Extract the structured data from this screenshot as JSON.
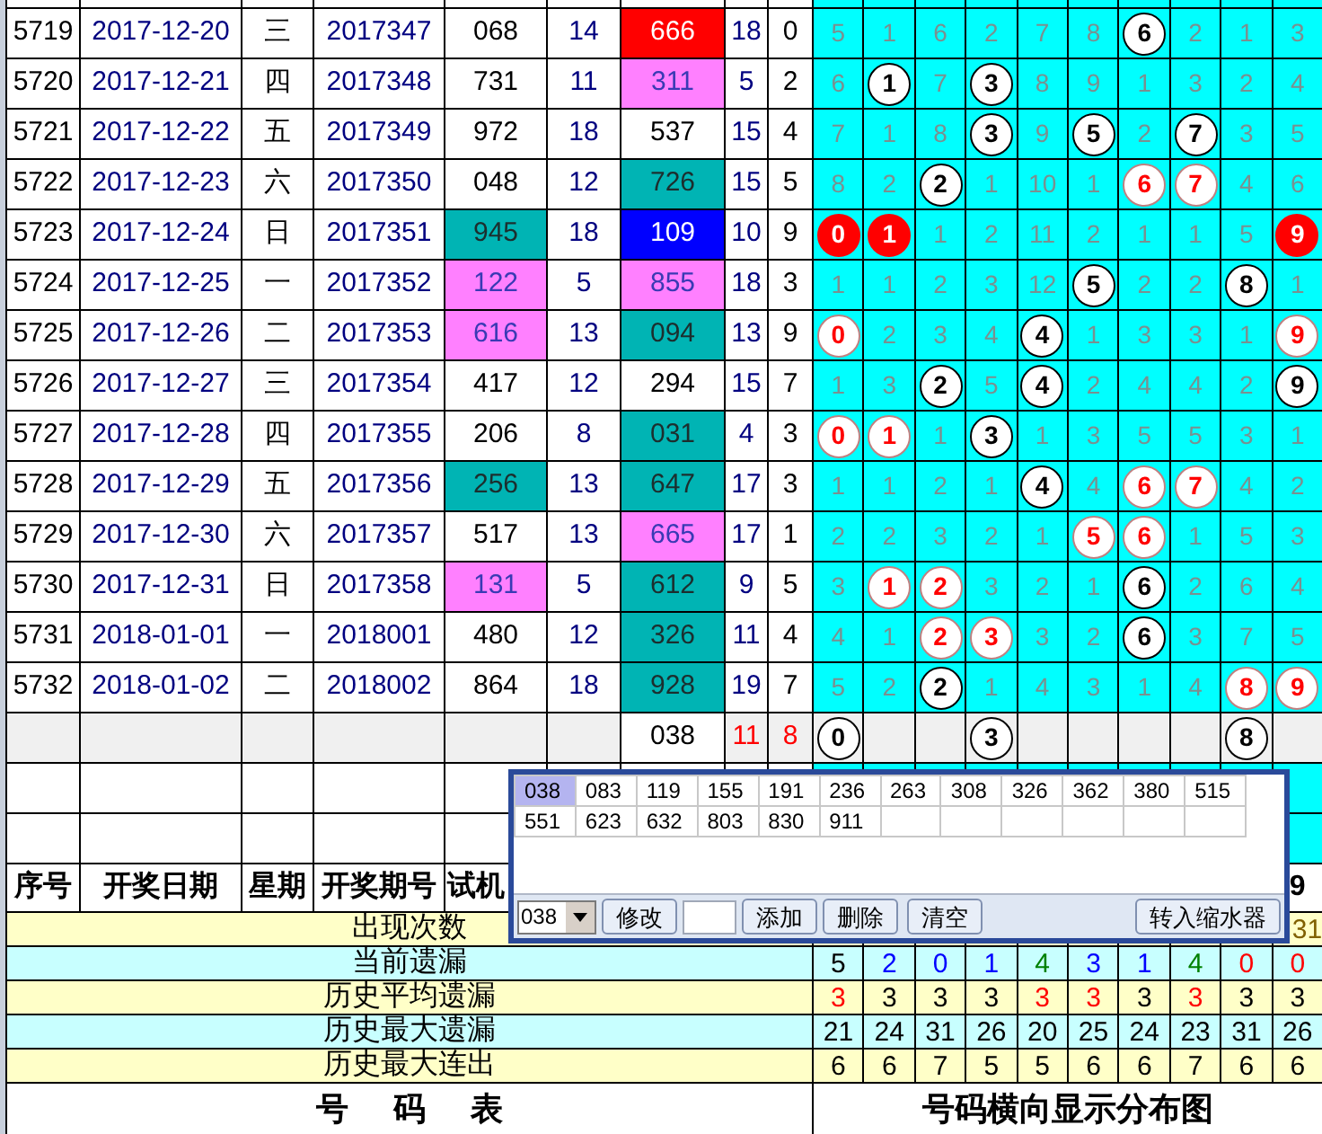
{
  "rows": [
    {
      "seq": "5719",
      "date": "2017-12-20",
      "weekday": "三",
      "issue": "2017347",
      "trial": {
        "text": "068"
      },
      "trial_sum": "14",
      "draw": {
        "text": "666",
        "color": "#ff0000"
      },
      "sum": "18",
      "span": "0",
      "dist": [
        {
          "text": "5",
          "kind": "miss"
        },
        {
          "text": "1",
          "kind": "miss"
        },
        {
          "text": "6",
          "kind": "miss"
        },
        {
          "text": "2",
          "kind": "miss"
        },
        {
          "text": "7",
          "kind": "miss"
        },
        {
          "text": "8",
          "kind": "miss"
        },
        {
          "text": "6",
          "kind": "hit"
        },
        {
          "text": "2",
          "kind": "miss"
        },
        {
          "text": "1",
          "kind": "miss"
        },
        {
          "text": "3",
          "kind": "miss"
        }
      ]
    },
    {
      "seq": "5720",
      "date": "2017-12-21",
      "weekday": "四",
      "issue": "2017348",
      "trial": {
        "text": "731"
      },
      "trial_sum": "11",
      "draw": {
        "text": "311",
        "color": "#ff80ff"
      },
      "sum": "5",
      "span": "2",
      "dist": [
        {
          "text": "6",
          "kind": "miss"
        },
        {
          "text": "1",
          "kind": "hit"
        },
        {
          "text": "7",
          "kind": "miss"
        },
        {
          "text": "3",
          "kind": "hit"
        },
        {
          "text": "8",
          "kind": "miss"
        },
        {
          "text": "9",
          "kind": "miss"
        },
        {
          "text": "1",
          "kind": "miss"
        },
        {
          "text": "3",
          "kind": "miss"
        },
        {
          "text": "2",
          "kind": "miss"
        },
        {
          "text": "4",
          "kind": "miss"
        }
      ]
    },
    {
      "seq": "5721",
      "date": "2017-12-22",
      "weekday": "五",
      "issue": "2017349",
      "trial": {
        "text": "972"
      },
      "trial_sum": "18",
      "draw": {
        "text": "537"
      },
      "sum": "15",
      "span": "4",
      "dist": [
        {
          "text": "7",
          "kind": "miss"
        },
        {
          "text": "1",
          "kind": "miss"
        },
        {
          "text": "8",
          "kind": "miss"
        },
        {
          "text": "3",
          "kind": "hit"
        },
        {
          "text": "9",
          "kind": "miss"
        },
        {
          "text": "5",
          "kind": "hit"
        },
        {
          "text": "2",
          "kind": "miss"
        },
        {
          "text": "7",
          "kind": "hit"
        },
        {
          "text": "3",
          "kind": "miss"
        },
        {
          "text": "5",
          "kind": "miss"
        }
      ]
    },
    {
      "seq": "5722",
      "date": "2017-12-23",
      "weekday": "六",
      "issue": "2017350",
      "trial": {
        "text": "048"
      },
      "trial_sum": "12",
      "draw": {
        "text": "726",
        "color": "#00b4b4"
      },
      "sum": "15",
      "span": "5",
      "dist": [
        {
          "text": "8",
          "kind": "miss"
        },
        {
          "text": "2",
          "kind": "miss"
        },
        {
          "text": "2",
          "kind": "hit"
        },
        {
          "text": "1",
          "kind": "miss"
        },
        {
          "text": "10",
          "kind": "miss"
        },
        {
          "text": "1",
          "kind": "miss"
        },
        {
          "text": "6",
          "kind": "hit_red"
        },
        {
          "text": "7",
          "kind": "hit_red"
        },
        {
          "text": "4",
          "kind": "miss"
        },
        {
          "text": "6",
          "kind": "miss"
        }
      ]
    },
    {
      "seq": "5723",
      "date": "2017-12-24",
      "weekday": "日",
      "issue": "2017351",
      "trial": {
        "text": "945",
        "color": "#00b4b4"
      },
      "trial_sum": "18",
      "draw": {
        "text": "109",
        "color": "#0000ff"
      },
      "sum": "10",
      "span": "9",
      "dist": [
        {
          "text": "0",
          "kind": "hit_solid"
        },
        {
          "text": "1",
          "kind": "hit_solid"
        },
        {
          "text": "1",
          "kind": "miss"
        },
        {
          "text": "2",
          "kind": "miss"
        },
        {
          "text": "11",
          "kind": "miss"
        },
        {
          "text": "2",
          "kind": "miss"
        },
        {
          "text": "1",
          "kind": "miss"
        },
        {
          "text": "1",
          "kind": "miss"
        },
        {
          "text": "5",
          "kind": "miss"
        },
        {
          "text": "9",
          "kind": "hit_solid"
        }
      ]
    },
    {
      "seq": "5724",
      "date": "2017-12-25",
      "weekday": "一",
      "issue": "2017352",
      "trial": {
        "text": "122",
        "color": "#ff80ff"
      },
      "trial_sum": "5",
      "draw": {
        "text": "855",
        "color": "#ff80ff"
      },
      "sum": "18",
      "span": "3",
      "dist": [
        {
          "text": "1",
          "kind": "miss"
        },
        {
          "text": "1",
          "kind": "miss"
        },
        {
          "text": "2",
          "kind": "miss"
        },
        {
          "text": "3",
          "kind": "miss"
        },
        {
          "text": "12",
          "kind": "miss"
        },
        {
          "text": "5",
          "kind": "hit"
        },
        {
          "text": "2",
          "kind": "miss"
        },
        {
          "text": "2",
          "kind": "miss"
        },
        {
          "text": "8",
          "kind": "hit"
        },
        {
          "text": "1",
          "kind": "miss"
        }
      ]
    },
    {
      "seq": "5725",
      "date": "2017-12-26",
      "weekday": "二",
      "issue": "2017353",
      "trial": {
        "text": "616",
        "color": "#ff80ff"
      },
      "trial_sum": "13",
      "draw": {
        "text": "094",
        "color": "#00b4b4"
      },
      "sum": "13",
      "span": "9",
      "dist": [
        {
          "text": "0",
          "kind": "hit_red"
        },
        {
          "text": "2",
          "kind": "miss"
        },
        {
          "text": "3",
          "kind": "miss"
        },
        {
          "text": "4",
          "kind": "miss"
        },
        {
          "text": "4",
          "kind": "hit"
        },
        {
          "text": "1",
          "kind": "miss"
        },
        {
          "text": "3",
          "kind": "miss"
        },
        {
          "text": "3",
          "kind": "miss"
        },
        {
          "text": "1",
          "kind": "miss"
        },
        {
          "text": "9",
          "kind": "hit_red"
        }
      ]
    },
    {
      "seq": "5726",
      "date": "2017-12-27",
      "weekday": "三",
      "issue": "2017354",
      "trial": {
        "text": "417"
      },
      "trial_sum": "12",
      "draw": {
        "text": "294"
      },
      "sum": "15",
      "span": "7",
      "dist": [
        {
          "text": "1",
          "kind": "miss"
        },
        {
          "text": "3",
          "kind": "miss"
        },
        {
          "text": "2",
          "kind": "hit"
        },
        {
          "text": "5",
          "kind": "miss"
        },
        {
          "text": "4",
          "kind": "hit"
        },
        {
          "text": "2",
          "kind": "miss"
        },
        {
          "text": "4",
          "kind": "miss"
        },
        {
          "text": "4",
          "kind": "miss"
        },
        {
          "text": "2",
          "kind": "miss"
        },
        {
          "text": "9",
          "kind": "hit"
        }
      ]
    },
    {
      "seq": "5727",
      "date": "2017-12-28",
      "weekday": "四",
      "issue": "2017355",
      "trial": {
        "text": "206"
      },
      "trial_sum": "8",
      "draw": {
        "text": "031",
        "color": "#00b4b4"
      },
      "sum": "4",
      "span": "3",
      "dist": [
        {
          "text": "0",
          "kind": "hit_red"
        },
        {
          "text": "1",
          "kind": "hit_red"
        },
        {
          "text": "1",
          "kind": "miss"
        },
        {
          "text": "3",
          "kind": "hit"
        },
        {
          "text": "1",
          "kind": "miss"
        },
        {
          "text": "3",
          "kind": "miss"
        },
        {
          "text": "5",
          "kind": "miss"
        },
        {
          "text": "5",
          "kind": "miss"
        },
        {
          "text": "3",
          "kind": "miss"
        },
        {
          "text": "1",
          "kind": "miss"
        }
      ]
    },
    {
      "seq": "5728",
      "date": "2017-12-29",
      "weekday": "五",
      "issue": "2017356",
      "trial": {
        "text": "256",
        "color": "#00b4b4"
      },
      "trial_sum": "13",
      "draw": {
        "text": "647",
        "color": "#00b4b4"
      },
      "sum": "17",
      "span": "3",
      "dist": [
        {
          "text": "1",
          "kind": "miss"
        },
        {
          "text": "1",
          "kind": "miss"
        },
        {
          "text": "2",
          "kind": "miss"
        },
        {
          "text": "1",
          "kind": "miss"
        },
        {
          "text": "4",
          "kind": "hit"
        },
        {
          "text": "4",
          "kind": "miss"
        },
        {
          "text": "6",
          "kind": "hit_red"
        },
        {
          "text": "7",
          "kind": "hit_red"
        },
        {
          "text": "4",
          "kind": "miss"
        },
        {
          "text": "2",
          "kind": "miss"
        }
      ]
    },
    {
      "seq": "5729",
      "date": "2017-12-30",
      "weekday": "六",
      "issue": "2017357",
      "trial": {
        "text": "517"
      },
      "trial_sum": "13",
      "draw": {
        "text": "665",
        "color": "#ff80ff"
      },
      "sum": "17",
      "span": "1",
      "dist": [
        {
          "text": "2",
          "kind": "miss"
        },
        {
          "text": "2",
          "kind": "miss"
        },
        {
          "text": "3",
          "kind": "miss"
        },
        {
          "text": "2",
          "kind": "miss"
        },
        {
          "text": "1",
          "kind": "miss"
        },
        {
          "text": "5",
          "kind": "hit_red"
        },
        {
          "text": "6",
          "kind": "hit_red"
        },
        {
          "text": "1",
          "kind": "miss"
        },
        {
          "text": "5",
          "kind": "miss"
        },
        {
          "text": "3",
          "kind": "miss"
        }
      ]
    },
    {
      "seq": "5730",
      "date": "2017-12-31",
      "weekday": "日",
      "issue": "2017358",
      "trial": {
        "text": "131",
        "color": "#ff80ff"
      },
      "trial_sum": "5",
      "draw": {
        "text": "612",
        "color": "#00b4b4"
      },
      "sum": "9",
      "span": "5",
      "dist": [
        {
          "text": "3",
          "kind": "miss"
        },
        {
          "text": "1",
          "kind": "hit_red"
        },
        {
          "text": "2",
          "kind": "hit_red"
        },
        {
          "text": "3",
          "kind": "miss"
        },
        {
          "text": "2",
          "kind": "miss"
        },
        {
          "text": "1",
          "kind": "miss"
        },
        {
          "text": "6",
          "kind": "hit"
        },
        {
          "text": "2",
          "kind": "miss"
        },
        {
          "text": "6",
          "kind": "miss"
        },
        {
          "text": "4",
          "kind": "miss"
        }
      ]
    },
    {
      "seq": "5731",
      "date": "2018-01-01",
      "weekday": "一",
      "issue": "2018001",
      "trial": {
        "text": "480"
      },
      "trial_sum": "12",
      "draw": {
        "text": "326",
        "color": "#00b4b4"
      },
      "sum": "11",
      "span": "4",
      "dist": [
        {
          "text": "4",
          "kind": "miss"
        },
        {
          "text": "1",
          "kind": "miss"
        },
        {
          "text": "2",
          "kind": "hit_red"
        },
        {
          "text": "3",
          "kind": "hit_red"
        },
        {
          "text": "3",
          "kind": "miss"
        },
        {
          "text": "2",
          "kind": "miss"
        },
        {
          "text": "6",
          "kind": "hit"
        },
        {
          "text": "3",
          "kind": "miss"
        },
        {
          "text": "7",
          "kind": "miss"
        },
        {
          "text": "5",
          "kind": "miss"
        }
      ]
    },
    {
      "seq": "5732",
      "date": "2018-01-02",
      "weekday": "二",
      "issue": "2018002",
      "trial": {
        "text": "864"
      },
      "trial_sum": "18",
      "draw": {
        "text": "928",
        "color": "#00b4b4"
      },
      "sum": "19",
      "span": "7",
      "dist": [
        {
          "text": "5",
          "kind": "miss"
        },
        {
          "text": "2",
          "kind": "miss"
        },
        {
          "text": "2",
          "kind": "hit"
        },
        {
          "text": "1",
          "kind": "miss"
        },
        {
          "text": "4",
          "kind": "miss"
        },
        {
          "text": "3",
          "kind": "miss"
        },
        {
          "text": "1",
          "kind": "miss"
        },
        {
          "text": "4",
          "kind": "miss"
        },
        {
          "text": "8",
          "kind": "hit_red"
        },
        {
          "text": "9",
          "kind": "hit_red"
        }
      ]
    }
  ],
  "pending_row": {
    "draw": "038",
    "sum": "11",
    "span": "8",
    "dist": [
      {
        "text": "0",
        "kind": "hit"
      },
      {
        "kind": "blank"
      },
      {
        "kind": "blank"
      },
      {
        "text": "3",
        "kind": "hit"
      },
      {
        "kind": "blank"
      },
      {
        "kind": "blank"
      },
      {
        "kind": "blank"
      },
      {
        "kind": "blank"
      },
      {
        "text": "8",
        "kind": "hit"
      },
      {
        "kind": "blank"
      }
    ]
  },
  "header": {
    "columns": [
      "序号",
      "开奖日期",
      "星期",
      "开奖期号",
      "试机"
    ],
    "last_column": "9"
  },
  "stats": [
    {
      "label": "出现次数",
      "values": [
        {
          "text": "31",
          "color": "#806000"
        }
      ]
    },
    {
      "label": "当前遗漏",
      "values": [
        {
          "text": "5",
          "color": "#000000"
        },
        {
          "text": "2",
          "color": "#0000ff"
        },
        {
          "text": "0",
          "color": "#0000ff"
        },
        {
          "text": "1",
          "color": "#0000ff"
        },
        {
          "text": "4",
          "color": "#008000"
        },
        {
          "text": "3",
          "color": "#0000ff"
        },
        {
          "text": "1",
          "color": "#0000ff"
        },
        {
          "text": "4",
          "color": "#008000"
        },
        {
          "text": "0",
          "color": "#ff0000"
        },
        {
          "text": "0",
          "color": "#ff0000"
        }
      ]
    },
    {
      "label": "历史平均遗漏",
      "values": [
        {
          "text": "3",
          "color": "#ff0000"
        },
        {
          "text": "3",
          "color": "#000000"
        },
        {
          "text": "3",
          "color": "#000000"
        },
        {
          "text": "3",
          "color": "#000000"
        },
        {
          "text": "3",
          "color": "#ff0000"
        },
        {
          "text": "3",
          "color": "#ff0000"
        },
        {
          "text": "3",
          "color": "#000000"
        },
        {
          "text": "3",
          "color": "#ff0000"
        },
        {
          "text": "3",
          "color": "#000000"
        },
        {
          "text": "3",
          "color": "#000000"
        }
      ]
    },
    {
      "label": "历史最大遗漏",
      "values": [
        {
          "text": "21"
        },
        {
          "text": "24"
        },
        {
          "text": "31"
        },
        {
          "text": "26"
        },
        {
          "text": "20"
        },
        {
          "text": "25"
        },
        {
          "text": "24"
        },
        {
          "text": "23"
        },
        {
          "text": "31"
        },
        {
          "text": "26"
        }
      ]
    },
    {
      "label": "历史最大连出",
      "values": [
        {
          "text": "6"
        },
        {
          "text": "6"
        },
        {
          "text": "7"
        },
        {
          "text": "5"
        },
        {
          "text": "5"
        },
        {
          "text": "6"
        },
        {
          "text": "6"
        },
        {
          "text": "7"
        },
        {
          "text": "6"
        },
        {
          "text": "6"
        }
      ]
    }
  ],
  "footer": {
    "left": "号码表",
    "right": "号码横向显示分布图"
  },
  "popup": {
    "numbers": [
      {
        "text": "038",
        "selected": true
      },
      {
        "text": "083",
        "selected": false
      },
      {
        "text": "119",
        "selected": false
      },
      {
        "text": "155",
        "selected": false
      },
      {
        "text": "191",
        "selected": false
      },
      {
        "text": "236",
        "selected": false
      },
      {
        "text": "263",
        "selected": false
      },
      {
        "text": "308",
        "selected": false
      },
      {
        "text": "326",
        "selected": false
      },
      {
        "text": "362",
        "selected": false
      },
      {
        "text": "380",
        "selected": false
      },
      {
        "text": "515",
        "selected": false
      },
      {
        "text": "551",
        "selected": false
      },
      {
        "text": "623",
        "selected": false
      },
      {
        "text": "632",
        "selected": false
      },
      {
        "text": "803",
        "selected": false
      },
      {
        "text": "830",
        "selected": false
      },
      {
        "text": "911",
        "selected": false
      }
    ],
    "combo_value": "038",
    "edit_button": "修改",
    "add_button": "添加",
    "delete_button": "删除",
    "clear_button": "清空",
    "transfer_button": "转入缩水器"
  }
}
